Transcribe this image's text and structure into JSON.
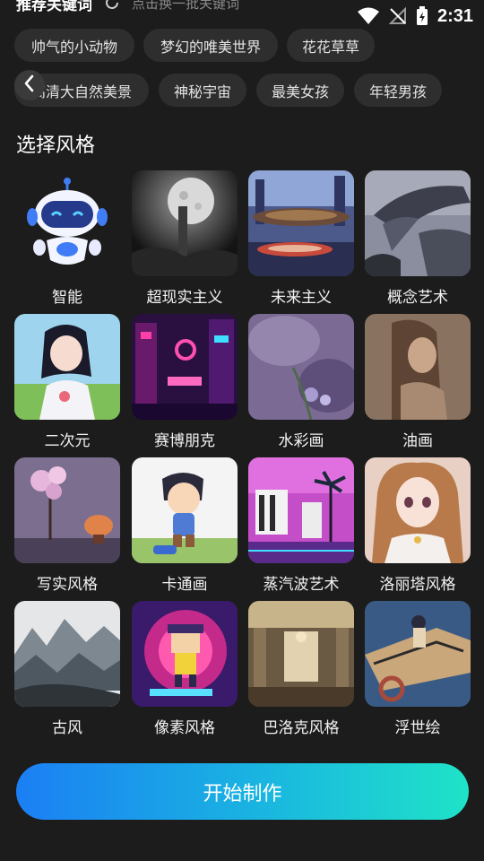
{
  "header": {
    "title": "推荐关键词",
    "hint": "点击换一批关键词",
    "refresh_icon": "refresh-icon"
  },
  "status_bar": {
    "time": "2:31",
    "icons": [
      "wifi-icon",
      "no-signal-icon",
      "battery-charging-icon"
    ]
  },
  "keywords": {
    "row1": [
      "帅气的小动物",
      "梦幻的唯美世界",
      "花花草草"
    ],
    "row2": [
      "高清大自然美景",
      "神秘宇宙",
      "最美女孩",
      "年轻男孩"
    ]
  },
  "back_icon": "chevron-left-icon",
  "section_title": "选择风格",
  "styles": [
    {
      "label": "智能"
    },
    {
      "label": "超现实主义"
    },
    {
      "label": "未来主义"
    },
    {
      "label": "概念艺术"
    },
    {
      "label": "二次元"
    },
    {
      "label": "赛博朋克"
    },
    {
      "label": "水彩画"
    },
    {
      "label": "油画"
    },
    {
      "label": "写实风格"
    },
    {
      "label": "卡通画"
    },
    {
      "label": "蒸汽波艺术"
    },
    {
      "label": "洛丽塔风格"
    },
    {
      "label": "古风"
    },
    {
      "label": "像素风格"
    },
    {
      "label": "巴洛克风格"
    },
    {
      "label": "浮世绘"
    }
  ],
  "start_button": {
    "label": "开始制作"
  },
  "colors": {
    "background": "#1c1c1c",
    "chip": "#2e2e2e",
    "button_gradient_start": "#1b7ff4",
    "button_gradient_end": "#1fe3c8"
  }
}
